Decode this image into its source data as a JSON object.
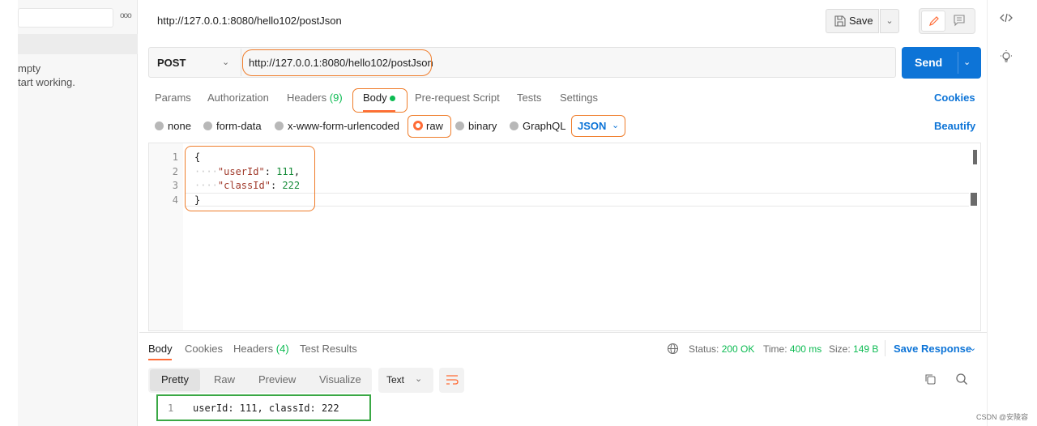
{
  "sidebar": {
    "menu_glyph": "ooo",
    "empty_line1": "mpty",
    "empty_line2": "tart working."
  },
  "request": {
    "title": "http://127.0.0.1:8080/hello102/postJson",
    "method": "POST",
    "url": "http://127.0.0.1:8080/hello102/postJson"
  },
  "header": {
    "save_label": "Save"
  },
  "send": {
    "label": "Send"
  },
  "tabs": {
    "params": "Params",
    "authorization": "Authorization",
    "headers": "Headers",
    "headers_count": "(9)",
    "body": "Body",
    "pre_request": "Pre-request Script",
    "tests": "Tests",
    "settings": "Settings",
    "cookies": "Cookies"
  },
  "body_types": {
    "none": "none",
    "form_data": "form-data",
    "urlencoded": "x-www-form-urlencoded",
    "raw": "raw",
    "binary": "binary",
    "graphql": "GraphQL",
    "format": "JSON",
    "beautify": "Beautify"
  },
  "editor": {
    "line_numbers": [
      "1",
      "2",
      "3",
      "4"
    ],
    "line1": "{",
    "line2_indent": "····",
    "line2_key": "\"userId\"",
    "line2_sep": ": ",
    "line2_val": "111",
    "line2_end": ",",
    "line3_indent": "····",
    "line3_key": "\"classId\"",
    "line3_sep": ": ",
    "line3_val": "222",
    "line4": "}"
  },
  "response": {
    "tab_body": "Body",
    "tab_cookies": "Cookies",
    "tab_headers": "Headers",
    "headers_count": "(4)",
    "tab_test_results": "Test Results",
    "status_label": "Status:",
    "status_value": "200 OK",
    "time_label": "Time:",
    "time_value": "400 ms",
    "size_label": "Size:",
    "size_value": "149 B",
    "save_response": "Save Response",
    "view_pretty": "Pretty",
    "view_raw": "Raw",
    "view_preview": "Preview",
    "view_visualize": "Visualize",
    "format": "Text",
    "line_number": "1",
    "body_text": "userId: 111, classId: 222"
  },
  "watermark": "CSDN @安陵容",
  "colors": {
    "accent_orange": "#ff6c37",
    "send_blue": "#0d74d7",
    "success_green": "#0cbb52",
    "annotation_orange": "#ef7d2b",
    "annotation_green": "#3aa845"
  },
  "icons": [
    "menu-dots-icon",
    "save-icon",
    "chevron-down-icon",
    "edit-pencil-icon",
    "comment-icon",
    "code-icon",
    "lightbulb-icon",
    "globe-icon",
    "wrap-lines-icon",
    "copy-icon",
    "search-icon"
  ]
}
